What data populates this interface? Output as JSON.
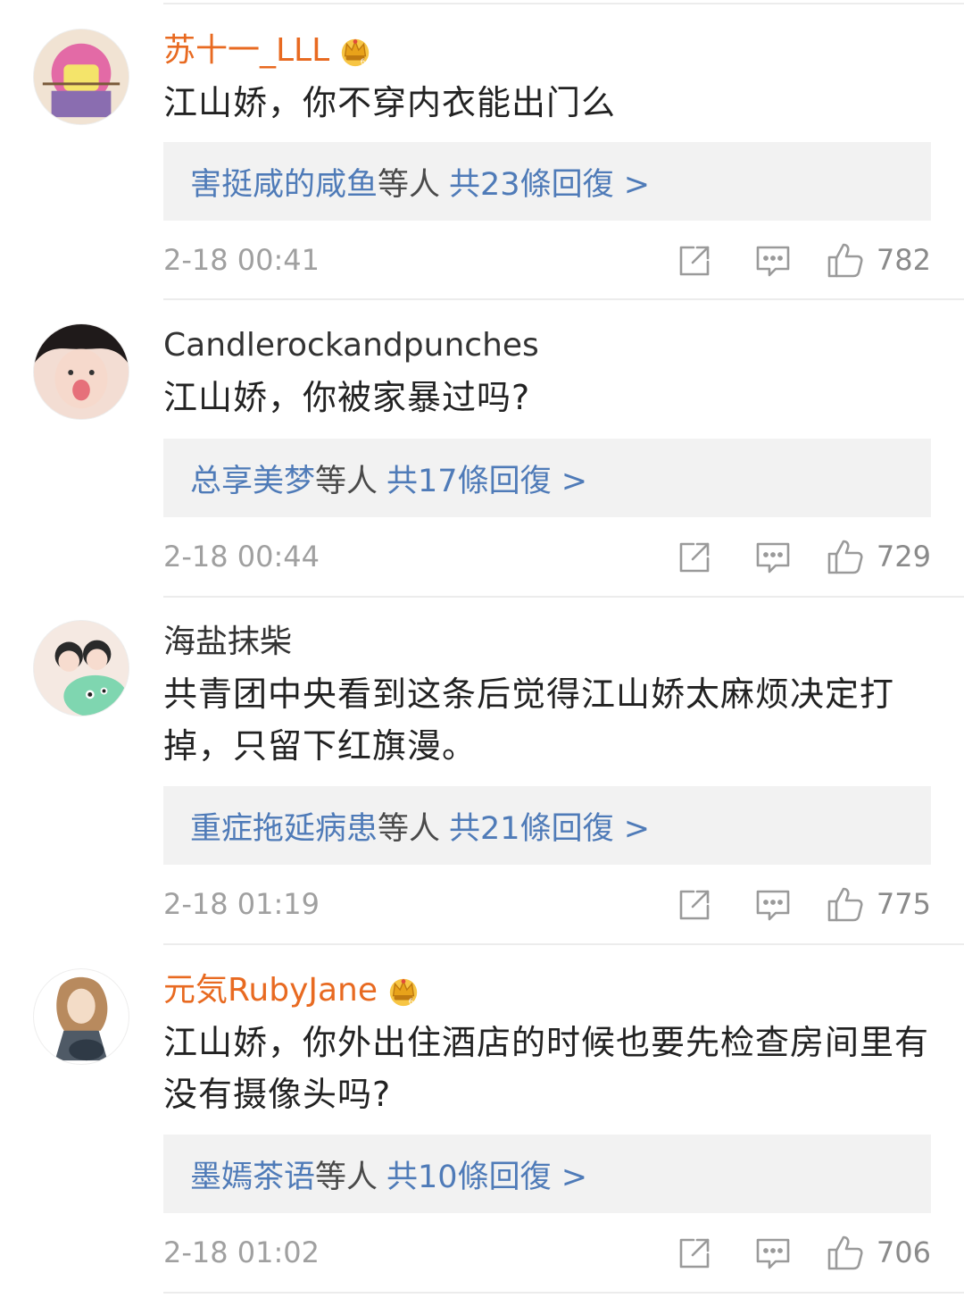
{
  "comments": [
    {
      "user": "苏十一_LLL",
      "vip": true,
      "text": "江山娇，你不穿内衣能出门么",
      "reply_names": "害挺咸的咸鱼",
      "reply_others": "等人",
      "reply_total": "共23條回復 >",
      "time": "2-18 00:41",
      "likes": "782"
    },
    {
      "user": "Candlerockandpunches",
      "vip": false,
      "text": "江山娇，你被家暴过吗?",
      "reply_names": "总享美梦",
      "reply_others": "等人",
      "reply_total": "共17條回復 >",
      "time": "2-18 00:44",
      "likes": "729"
    },
    {
      "user": "海盐抹柴",
      "vip": false,
      "text": "共青团中央看到这条后觉得江山娇太麻烦决定打掉，只留下红旗漫。",
      "reply_names": "重症拖延病患",
      "reply_others": "等人",
      "reply_total": "共21條回復 >",
      "time": "2-18 01:19",
      "likes": "775"
    },
    {
      "user": "元気RubyJane",
      "vip": true,
      "text": "江山娇，你外出住酒店的时候也要先检查房间里有没有摄像头吗?",
      "reply_names": "墨嫣茶语",
      "reply_others": "等人",
      "reply_total": "共10條回復 >",
      "time": "2-18 01:02",
      "likes": "706"
    }
  ],
  "colors": {
    "vip_name": "#e86a21",
    "link": "#4f7bb8",
    "reply_bg": "#f2f2f2",
    "meta": "#a0a0a0"
  },
  "icons": {
    "vip": "crown-icon",
    "repost": "repost-icon",
    "reply": "comment-icon",
    "like": "thumbs-up-icon"
  }
}
